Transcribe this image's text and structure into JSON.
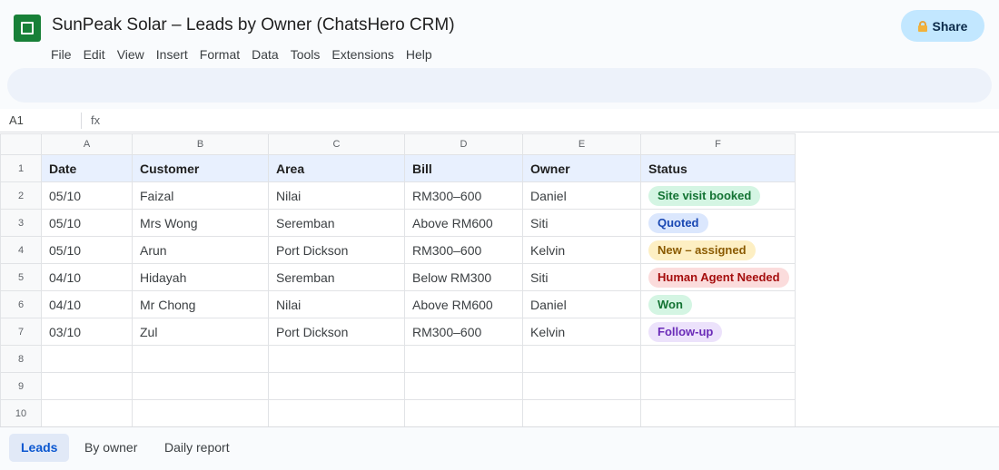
{
  "doc": {
    "title": "SunPeak Solar – Leads by Owner (ChatsHero CRM)"
  },
  "menu": [
    "File",
    "Edit",
    "View",
    "Insert",
    "Format",
    "Data",
    "Tools",
    "Extensions",
    "Help"
  ],
  "share": {
    "label": "Share",
    "icon": "lock-icon"
  },
  "formula_bar": {
    "cell_ref": "A1",
    "fx_label": "fx",
    "value": ""
  },
  "columns": [
    "A",
    "B",
    "C",
    "D",
    "E",
    "F"
  ],
  "row_numbers": [
    "1",
    "2",
    "3",
    "4",
    "5",
    "6",
    "7",
    "8",
    "9",
    "10"
  ],
  "table": {
    "headers": [
      "Date",
      "Customer",
      "Area",
      "Bill",
      "Owner",
      "Status"
    ],
    "rows": [
      {
        "date": "05/10",
        "customer": "Faizal",
        "area": "Nilai",
        "bill": "RM300–600",
        "owner": "Daniel",
        "status": "Site visit booked",
        "status_bg": "#d4f5e3",
        "status_fg": "#137333"
      },
      {
        "date": "05/10",
        "customer": "Mrs Wong",
        "area": "Seremban",
        "bill": "Above RM600",
        "owner": "Siti",
        "status": "Quoted",
        "status_bg": "#dbe7fd",
        "status_fg": "#1a48b3"
      },
      {
        "date": "05/10",
        "customer": "Arun",
        "area": "Port Dickson",
        "bill": "RM300–600",
        "owner": "Kelvin",
        "status": "New – assigned",
        "status_bg": "#fdefc3",
        "status_fg": "#8a5a00"
      },
      {
        "date": "04/10",
        "customer": "Hidayah",
        "area": "Seremban",
        "bill": "Below RM300",
        "owner": "Siti",
        "status": "Human Agent Needed",
        "status_bg": "#fbdcdc",
        "status_fg": "#a50e0e"
      },
      {
        "date": "04/10",
        "customer": "Mr Chong",
        "area": "Nilai",
        "bill": "Above RM600",
        "owner": "Daniel",
        "status": "Won",
        "status_bg": "#d4f5e3",
        "status_fg": "#137333"
      },
      {
        "date": "03/10",
        "customer": "Zul",
        "area": "Port Dickson",
        "bill": "RM300–600",
        "owner": "Kelvin",
        "status": "Follow-up",
        "status_bg": "#ece2fb",
        "status_fg": "#6a2bb8"
      }
    ]
  },
  "tabs": [
    {
      "label": "Leads",
      "active": true
    },
    {
      "label": "By owner",
      "active": false
    },
    {
      "label": "Daily report",
      "active": false
    }
  ]
}
